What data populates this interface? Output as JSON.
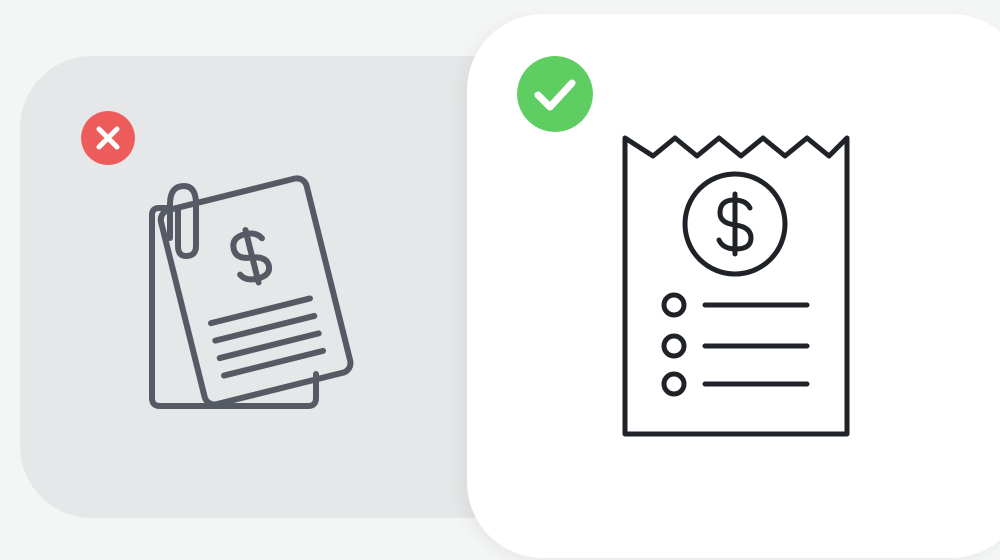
{
  "colors": {
    "background": "#f4f5f5",
    "bad_card": "#e5e7e8",
    "good_card": "#ffffff",
    "bad_badge": "#ee5b5b",
    "good_badge": "#5fce62",
    "bad_icon_stroke": "#565a64",
    "good_icon_stroke": "#1f2227"
  },
  "examples": [
    {
      "verdict": "incorrect",
      "badge_icon": "x-icon",
      "icon": "clipped-invoice-documents-icon"
    },
    {
      "verdict": "correct",
      "badge_icon": "checkmark-icon",
      "icon": "receipt-icon"
    }
  ]
}
